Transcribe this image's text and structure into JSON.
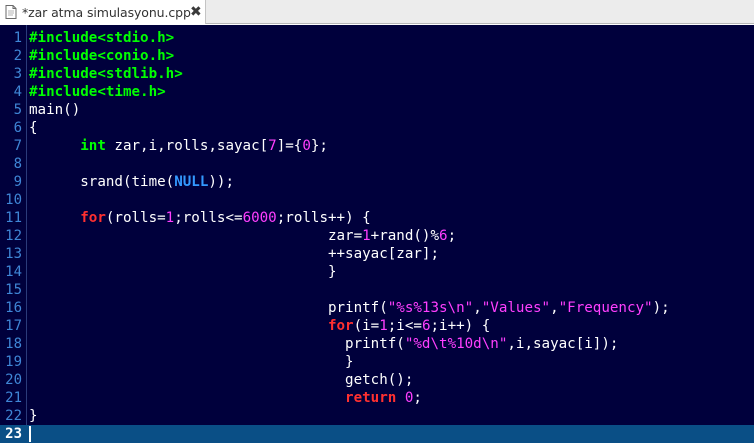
{
  "tab": {
    "title": "*zar atma simulasyonu.cpp",
    "close_glyph": "✖",
    "file_icon": "text-file-icon"
  },
  "colors": {
    "background": "#00003c",
    "current_line": "#0a4f86",
    "line_number": "#3f86d6",
    "default": "#ffffff",
    "preprocessor": "#00ff00",
    "keyword": "#ff3030",
    "type": "#00ff00",
    "number": "#ff3fff",
    "string": "#ff3fff",
    "escape": "#ff3fff"
  },
  "editor": {
    "current_line": 23,
    "lines": [
      {
        "n": "1",
        "t": [
          [
            "#include",
            "preprocessor"
          ],
          [
            "<stdio.h>",
            "header"
          ]
        ]
      },
      {
        "n": "2",
        "t": [
          [
            "#include",
            "preprocessor"
          ],
          [
            "<conio.h>",
            "header"
          ]
        ]
      },
      {
        "n": "3",
        "t": [
          [
            "#include",
            "preprocessor"
          ],
          [
            "<stdlib.h>",
            "header"
          ]
        ]
      },
      {
        "n": "4",
        "t": [
          [
            "#include",
            "preprocessor"
          ],
          [
            "<time.h>",
            "header"
          ]
        ]
      },
      {
        "n": "5",
        "t": [
          [
            "main()",
            "plain"
          ]
        ]
      },
      {
        "n": "6",
        "t": [
          [
            "{",
            "plain"
          ]
        ]
      },
      {
        "n": "7",
        "t": [
          [
            "      ",
            "plain"
          ],
          [
            "int",
            "type"
          ],
          [
            " zar,i,rolls,sayac[",
            "plain"
          ],
          [
            "7",
            "number"
          ],
          [
            "]={",
            "plain"
          ],
          [
            "0",
            "number"
          ],
          [
            "};",
            "plain"
          ]
        ]
      },
      {
        "n": "8",
        "t": []
      },
      {
        "n": "9",
        "t": [
          [
            "      srand(time(",
            "plain"
          ],
          [
            "NULL",
            "null"
          ],
          [
            "));",
            "plain"
          ]
        ]
      },
      {
        "n": "10",
        "t": []
      },
      {
        "n": "11",
        "t": [
          [
            "      ",
            "plain"
          ],
          [
            "for",
            "keyword"
          ],
          [
            "(rolls=",
            "plain"
          ],
          [
            "1",
            "number"
          ],
          [
            ";rolls<=",
            "plain"
          ],
          [
            "6000",
            "number"
          ],
          [
            ";rolls++) {",
            "plain"
          ]
        ]
      },
      {
        "n": "12",
        "t": [
          [
            "                                   zar=",
            "plain"
          ],
          [
            "1",
            "number"
          ],
          [
            "+rand()%",
            "plain"
          ],
          [
            "6",
            "number"
          ],
          [
            ";",
            "plain"
          ]
        ]
      },
      {
        "n": "13",
        "t": [
          [
            "                                   ++sayac[zar];",
            "plain"
          ]
        ]
      },
      {
        "n": "14",
        "t": [
          [
            "                                   }",
            "plain"
          ]
        ]
      },
      {
        "n": "15",
        "t": []
      },
      {
        "n": "16",
        "t": [
          [
            "                                   printf(",
            "plain"
          ],
          [
            "\"%s%13s",
            "string"
          ],
          [
            "\\n",
            "escape"
          ],
          [
            "\"",
            "string"
          ],
          [
            ",",
            "plain"
          ],
          [
            "\"Values\"",
            "string"
          ],
          [
            ",",
            "plain"
          ],
          [
            "\"Frequency\"",
            "string"
          ],
          [
            ");",
            "plain"
          ]
        ]
      },
      {
        "n": "17",
        "t": [
          [
            "                                   ",
            "plain"
          ],
          [
            "for",
            "keyword"
          ],
          [
            "(i=",
            "plain"
          ],
          [
            "1",
            "number"
          ],
          [
            ";i<=",
            "plain"
          ],
          [
            "6",
            "number"
          ],
          [
            ";i++) {",
            "plain"
          ]
        ]
      },
      {
        "n": "18",
        "t": [
          [
            "                                     printf(",
            "plain"
          ],
          [
            "\"%d",
            "string"
          ],
          [
            "\\t",
            "escape"
          ],
          [
            "%10d",
            "string"
          ],
          [
            "\\n",
            "escape"
          ],
          [
            "\"",
            "string"
          ],
          [
            ",i,sayac[i]);",
            "plain"
          ]
        ]
      },
      {
        "n": "19",
        "t": [
          [
            "                                     }",
            "plain"
          ]
        ]
      },
      {
        "n": "20",
        "t": [
          [
            "                                     getch();",
            "plain"
          ]
        ]
      },
      {
        "n": "21",
        "t": [
          [
            "                                     ",
            "plain"
          ],
          [
            "return",
            "keyword"
          ],
          [
            " ",
            "plain"
          ],
          [
            "0",
            "number"
          ],
          [
            ";",
            "plain"
          ]
        ]
      },
      {
        "n": "22",
        "t": [
          [
            "}",
            "plain"
          ]
        ]
      },
      {
        "n": "23",
        "t": []
      }
    ]
  }
}
